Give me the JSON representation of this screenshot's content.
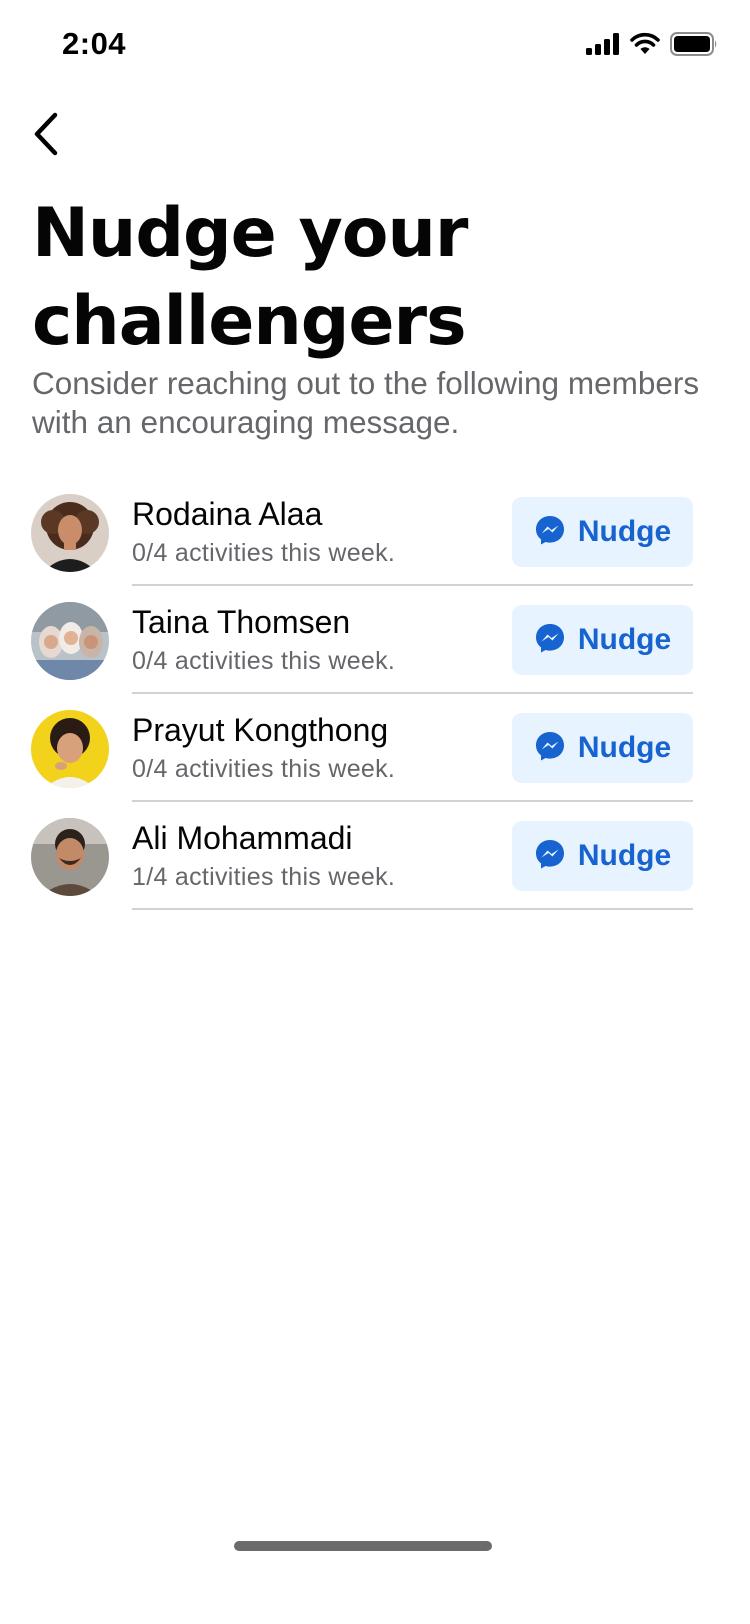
{
  "status_bar": {
    "time": "2:04",
    "signal_icon": "cellular-signal-icon",
    "wifi_icon": "wifi-icon",
    "battery_icon": "battery-icon"
  },
  "nav": {
    "back_icon": "chevron-left-icon"
  },
  "header": {
    "title": "Nudge your challengers",
    "subtitle": "Consider reaching out to the following members with an encouraging message."
  },
  "members": [
    {
      "name": "Rodaina Alaa",
      "progress": "0/4 activities this week.",
      "nudge_label": "Nudge"
    },
    {
      "name": "Taina Thomsen",
      "progress": "0/4 activities this week.",
      "nudge_label": "Nudge"
    },
    {
      "name": "Prayut Kongthong",
      "progress": "0/4 activities this week.",
      "nudge_label": "Nudge"
    },
    {
      "name": "Ali Mohammadi",
      "progress": "1/4 activities this week.",
      "nudge_label": "Nudge"
    }
  ],
  "colors": {
    "accent": "#1763cf",
    "nudge_button_bg": "#e7f3ff",
    "secondary_text": "#65676b",
    "divider": "#cfd2d6"
  }
}
